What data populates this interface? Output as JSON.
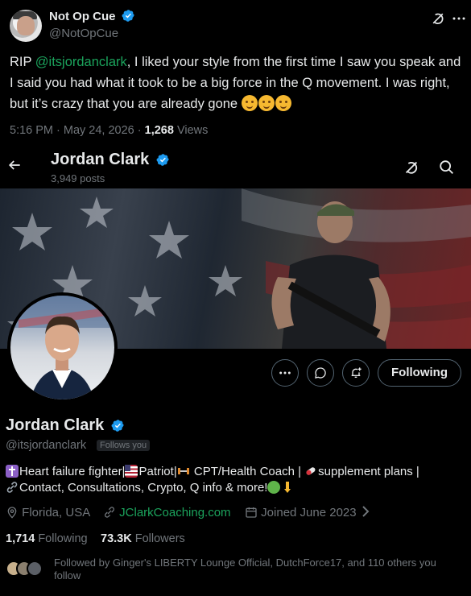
{
  "tweet": {
    "display_name": "Not Op Cue",
    "handle": "@NotOpCue",
    "text_before": "RIP ",
    "mention": "@itsjordanclark",
    "text_after": ", I liked your style from the first time I saw you speak and I said you had what it took to be a big force in the Q movement. I was right, but it’s crazy that you are already gone ",
    "time": "5:16 PM · May 24, 2026 · ",
    "views_count": "1,268",
    "views_label": " Views"
  },
  "profile_header": {
    "name": "Jordan Clark",
    "posts": "3,949 posts"
  },
  "actions": {
    "following_label": "Following"
  },
  "profile": {
    "name": "Jordan Clark",
    "handle": "@itsjordanclark",
    "follows_you": "Follows you",
    "bio_line1_a": "Heart failure fighter|",
    "bio_line1_b": "Patriot|",
    "bio_line1_c": " CPT/Health Coach | ",
    "bio_line1_d": "supplement plans |",
    "bio_line2": "Contact, Consultations, Crypto, Q info & more!",
    "location": "Florida, USA",
    "website": "JClarkCoaching.com",
    "joined": "Joined June 2023",
    "following_count": "1,714",
    "following_label": " Following",
    "followers_count": "73.3K",
    "followers_label": " Followers",
    "followed_by": "Followed by Ginger's LIBERTY Lounge Official, DutchForce17, and 110 others you follow"
  },
  "colors": {
    "accent": "#1d9bf0",
    "link_green": "#1ba35c",
    "muted": "#71767b",
    "background": "#000000"
  },
  "icons": [
    "verified-badge-icon",
    "more-icon",
    "grok-icon",
    "back-arrow-icon",
    "search-icon",
    "message-icon",
    "notification-add-icon",
    "location-icon",
    "link-icon",
    "calendar-icon",
    "cross-icon",
    "flag-icon",
    "weight-icon",
    "pill-icon",
    "frog-icon",
    "pointing-down-icon"
  ]
}
